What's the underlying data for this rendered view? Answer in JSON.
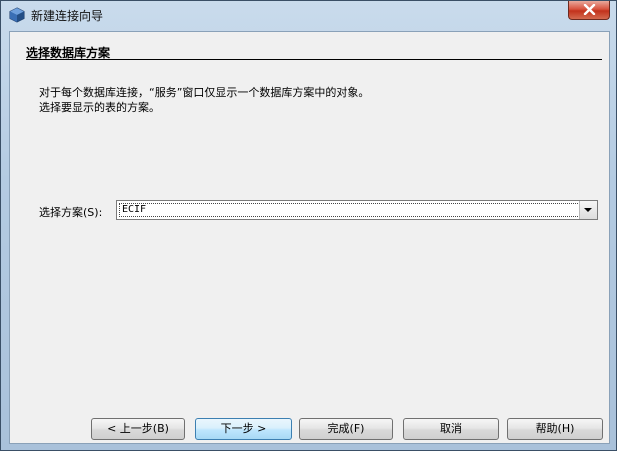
{
  "window": {
    "title": "新建连接向导"
  },
  "step": {
    "title": "选择数据库方案",
    "description_line1": "对于每个数据库连接，“服务”窗口仅显示一个数据库方案中的对象。",
    "description_line2": "选择要显示的表的方案。"
  },
  "schema": {
    "label": "选择方案(S):",
    "selected": "ECIF"
  },
  "buttons": {
    "back": "< 上一步(B)",
    "next": "下一步 >",
    "finish": "完成(F)",
    "cancel": "取消",
    "help": "帮助(H)"
  },
  "colors": {
    "close_button": "#c2321c",
    "default_button_border": "#3c7fb1",
    "client_bg": "#f0f0f0"
  },
  "icons": {
    "app": "netbeans-cube-icon",
    "close": "close-icon",
    "dropdown": "chevron-down-icon"
  }
}
